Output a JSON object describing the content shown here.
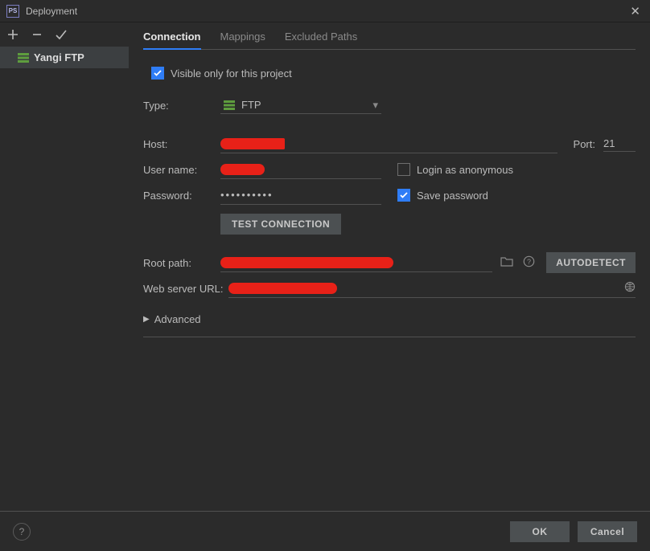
{
  "window": {
    "title": "Deployment"
  },
  "sidebar": {
    "servers": [
      {
        "name": "Yangi FTP"
      }
    ]
  },
  "tabs": [
    {
      "id": "connection",
      "label": "Connection",
      "active": true
    },
    {
      "id": "mappings",
      "label": "Mappings",
      "active": false
    },
    {
      "id": "excluded",
      "label": "Excluded Paths",
      "active": false
    }
  ],
  "form": {
    "visible_only_label": "Visible only for this project",
    "visible_only_checked": true,
    "type_label": "Type:",
    "type_value": "FTP",
    "host_label": "Host:",
    "port_label": "Port:",
    "port_value": "21",
    "username_label": "User name:",
    "password_label": "Password:",
    "password_mask": "••••••••••",
    "login_anon_label": "Login as anonymous",
    "login_anon_checked": false,
    "save_pwd_label": "Save password",
    "save_pwd_checked": true,
    "test_connection_label": "Test Connection",
    "root_path_label": "Root path:",
    "autodetect_label": "Autodetect",
    "web_url_label": "Web server URL:",
    "advanced_label": "Advanced"
  },
  "footer": {
    "ok": "OK",
    "cancel": "Cancel"
  }
}
